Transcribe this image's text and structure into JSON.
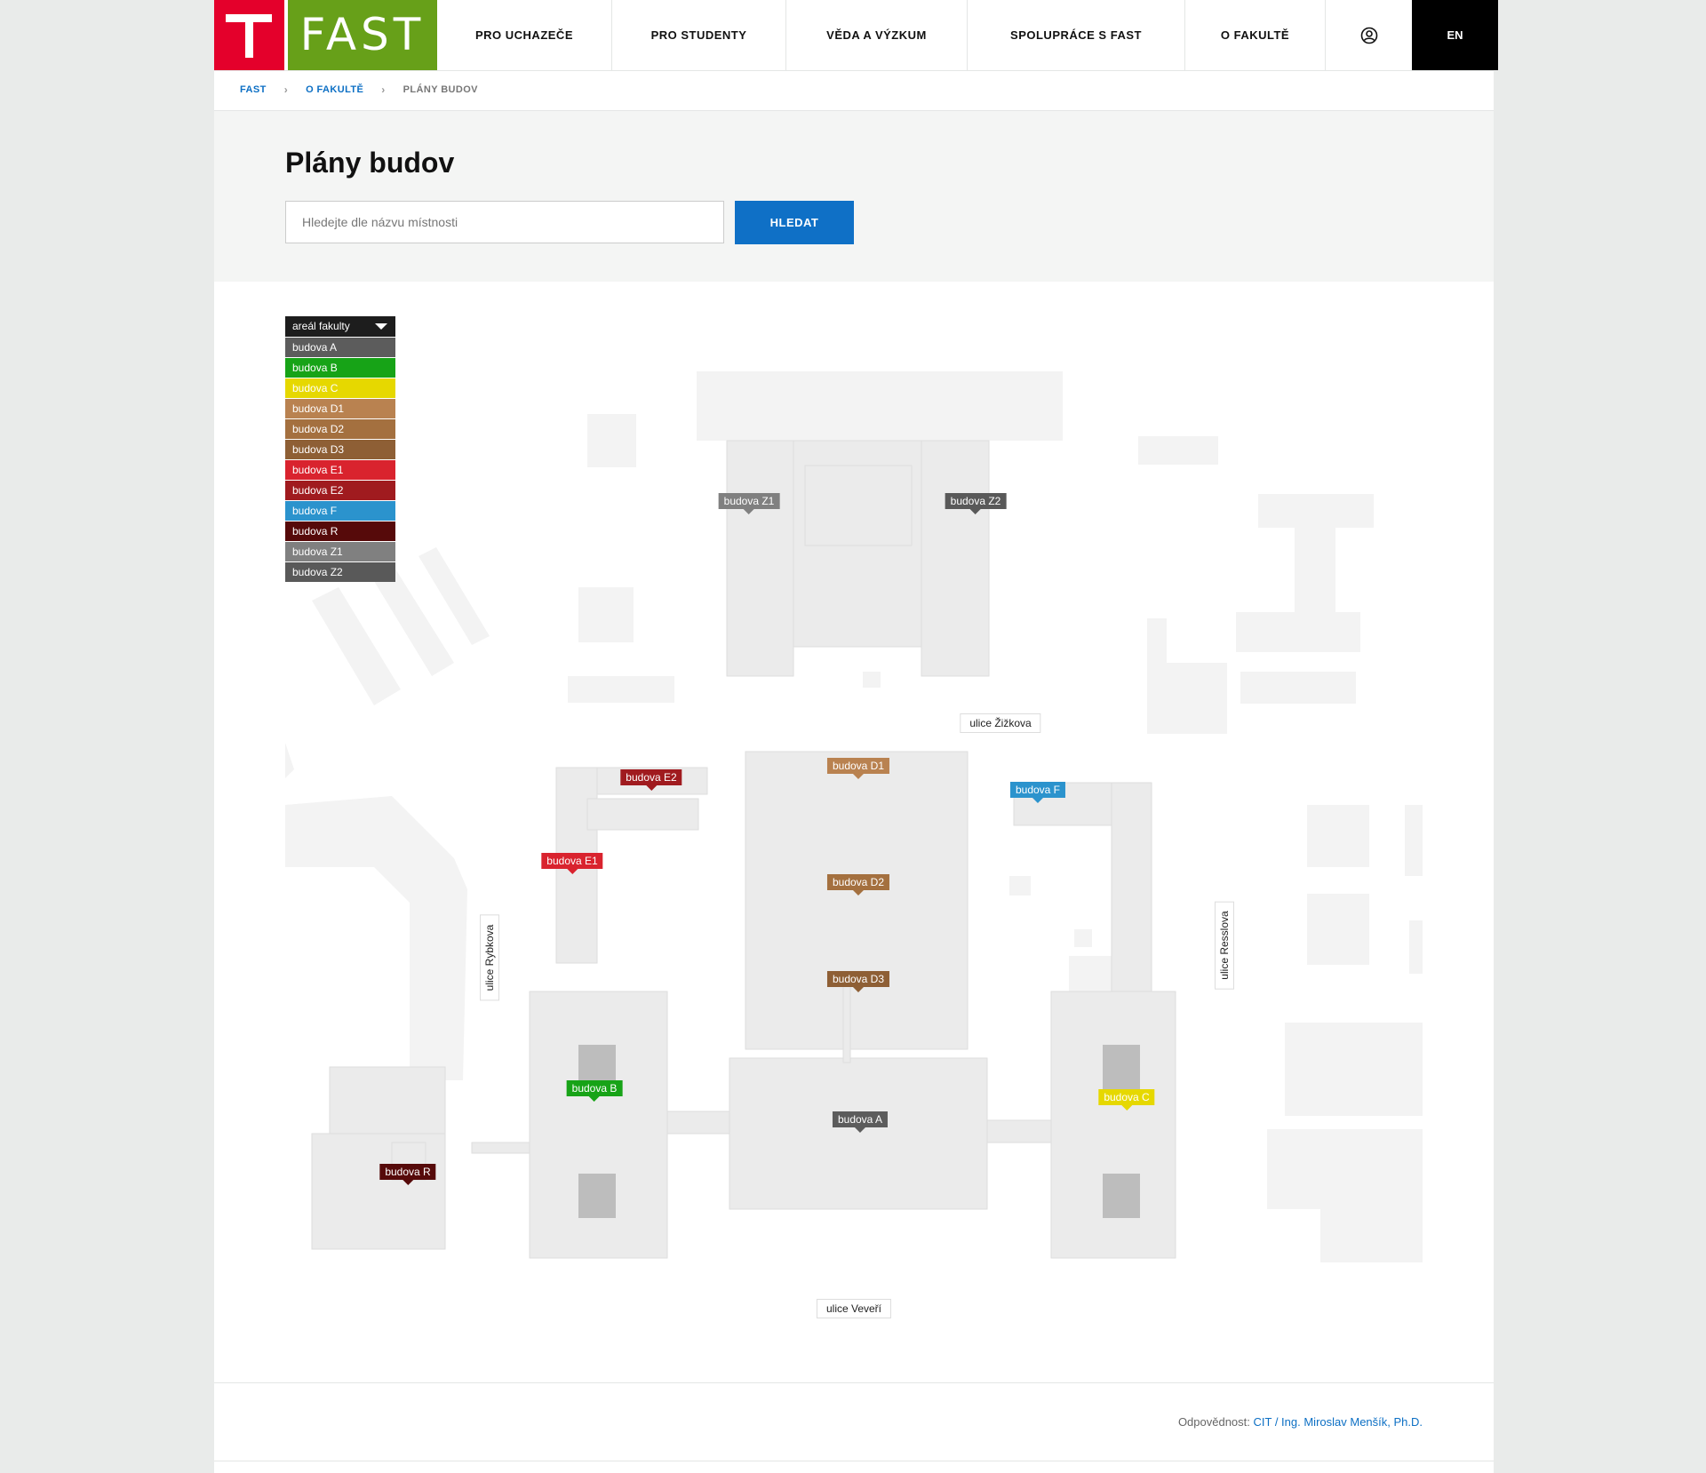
{
  "header": {
    "logo_text": "FAST",
    "nav": [
      {
        "label": "PRO UCHAZEČE"
      },
      {
        "label": "PRO STUDENTY"
      },
      {
        "label": "VĚDA A VÝZKUM"
      },
      {
        "label": "SPOLUPRÁCE S FAST"
      },
      {
        "label": "O FAKULTĚ"
      }
    ],
    "user_icon": "user-circle-icon",
    "lang": "EN"
  },
  "breadcrumb": [
    "FAST",
    "O FAKULTĚ",
    "PLÁNY BUDOV"
  ],
  "page": {
    "title": "Plány budov",
    "search_placeholder": "Hledejte dle názvu místnosti",
    "search_button": "HLEDAT"
  },
  "legend": {
    "selected": "areál fakulty",
    "items": [
      {
        "label": "budova A",
        "color": "#5c5c5c"
      },
      {
        "label": "budova B",
        "color": "#17a317"
      },
      {
        "label": "budova C",
        "color": "#e6d800"
      },
      {
        "label": "budova D1",
        "color": "#b98250"
      },
      {
        "label": "budova D2",
        "color": "#a4703f"
      },
      {
        "label": "budova D3",
        "color": "#8e5f35"
      },
      {
        "label": "budova E1",
        "color": "#d9232e"
      },
      {
        "label": "budova E2",
        "color": "#a01b1f"
      },
      {
        "label": "budova F",
        "color": "#2b93cd"
      },
      {
        "label": "budova R",
        "color": "#560a0a"
      },
      {
        "label": "budova Z1",
        "color": "#808080"
      },
      {
        "label": "budova Z2",
        "color": "#595959"
      }
    ]
  },
  "map_tags": {
    "z1": "budova Z1",
    "z2": "budova Z2",
    "e2": "budova E2",
    "d1": "budova D1",
    "f": "budova F",
    "e1": "budova E1",
    "d2": "budova D2",
    "d3": "budova D3",
    "b": "budova B",
    "a": "budova A",
    "c": "budova C",
    "r": "budova R"
  },
  "streets": {
    "zizkova": "ulice Žižkova",
    "rybkova": "ulice Rybkova",
    "resslova": "ulice Resslova",
    "veveri": "ulice Veveří"
  },
  "footer": {
    "label": "Odpovědnost:",
    "link": "CIT / Ing. Miroslav Menšík, Ph.D."
  }
}
